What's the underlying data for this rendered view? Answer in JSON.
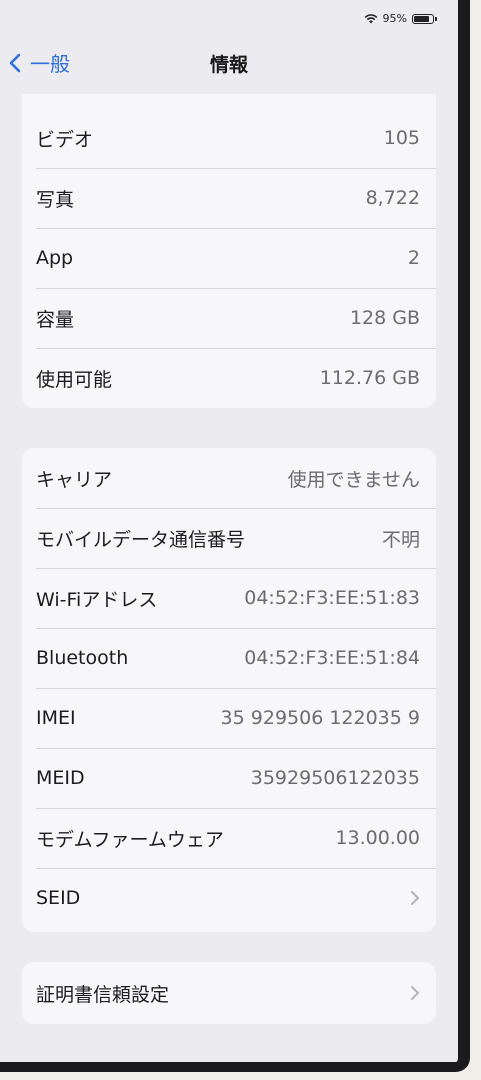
{
  "status": {
    "battery_text": "95%",
    "battery_level": 0.95
  },
  "nav": {
    "back_label": "一般",
    "title": "情報"
  },
  "group1": [
    {
      "label": "ビデオ",
      "value": "105"
    },
    {
      "label": "写真",
      "value": "8,722"
    },
    {
      "label": "App",
      "value": "2"
    },
    {
      "label": "容量",
      "value": "128 GB"
    },
    {
      "label": "使用可能",
      "value": "112.76 GB"
    }
  ],
  "group2": [
    {
      "label": "キャリア",
      "value": "使用できません"
    },
    {
      "label": "モバイルデータ通信番号",
      "value": "不明"
    },
    {
      "label": "Wi-Fiアドレス",
      "value": "04:52:F3:EE:51:83"
    },
    {
      "label": "Bluetooth",
      "value": "04:52:F3:EE:51:84"
    },
    {
      "label": "IMEI",
      "value": "35 929506 122035 9"
    },
    {
      "label": "MEID",
      "value": "35929506122035"
    },
    {
      "label": "モデムファームウェア",
      "value": "13.00.00"
    },
    {
      "label": "SEID",
      "value": ""
    }
  ],
  "group3": [
    {
      "label": "証明書信頼設定",
      "value": ""
    }
  ],
  "colors": {
    "accent": "#2f6fd8",
    "secondary_text": "#6c6c70",
    "cell_background": "#f7f7f9"
  }
}
